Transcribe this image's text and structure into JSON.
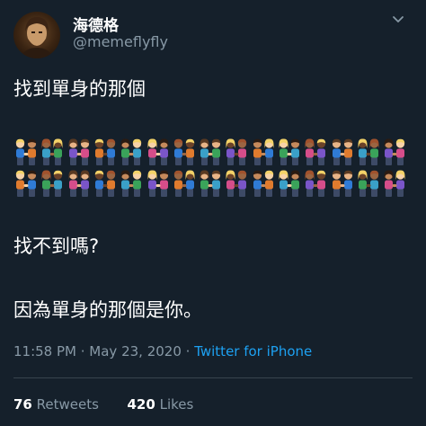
{
  "user": {
    "display_name": "海德格",
    "handle": "@memeflyfly",
    "avatar_icon": "profile-photo"
  },
  "menu_icon": "chevron-down-icon",
  "tweet": {
    "line1": "找到單身的那個",
    "emoji_rows": [
      [
        "couple",
        "couple",
        "couple",
        "couple",
        "couple",
        "couple",
        "couple",
        "couple",
        "couple",
        "couple",
        "couple",
        "couple",
        "couple",
        "couple",
        "couple"
      ],
      [
        "couple",
        "couple",
        "couple",
        "couple",
        "couple",
        "couple",
        "couple",
        "couple",
        "couple",
        "couple",
        "couple",
        "couple",
        "couple",
        "couple",
        "couple"
      ]
    ],
    "line2": "找不到嗎?",
    "line3": "因為單身的那個是你。"
  },
  "meta": {
    "time": "11:58 PM",
    "separator": " · ",
    "date": "May 23, 2020",
    "separator2": " · ",
    "source": "Twitter for iPhone"
  },
  "stats": {
    "retweets_count": "76",
    "retweets_label": "Retweets",
    "likes_count": "420",
    "likes_label": "Likes"
  },
  "colors": {
    "background": "#15202b",
    "text": "#ffffff",
    "muted": "#8899a6",
    "accent": "#1da1f2",
    "divider": "#38444d"
  }
}
